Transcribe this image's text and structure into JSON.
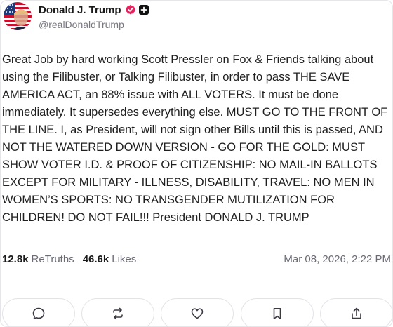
{
  "author": {
    "display_name": "Donald J. Trump",
    "handle": "@realDonaldTrump",
    "avatar_icon": "flag-portrait-avatar",
    "verified_icon": "verified-badge-icon",
    "verified_color": "#e0245e",
    "plus_icon": "plus-badge-icon"
  },
  "post": {
    "text": "Great Job by hard working Scott Pressler on Fox & Friends talking about using the Filibuster, or Talking Filibuster, in order to pass THE SAVE AMERICA ACT, an 88% issue with ALL VOTERS. It must be done immediately. It supersedes everything else. MUST GO TO THE FRONT OF THE LINE. I, as President, will not sign other Bills until this is passed, AND NOT THE WATERED DOWN VERSION - GO FOR THE GOLD: MUST SHOW VOTER I.D. & PROOF OF CITIZENSHIP: NO MAIL-IN BALLOTS EXCEPT FOR MILITARY - ILLNESS, DISABILITY, TRAVEL: NO MEN IN WOMEN’S SPORTS: NO TRANSGENDER MUTILIZATION FOR CHILDREN! DO NOT FAIL!!! President DONALD J. TRUMP"
  },
  "stats": {
    "retruths_count": "12.8k",
    "retruths_label": "ReTruths",
    "likes_count": "46.6k",
    "likes_label": "Likes",
    "timestamp": "Mar 08, 2026, 2:22 PM"
  },
  "actions": [
    {
      "name": "reply",
      "icon": "comment-icon"
    },
    {
      "name": "retruth",
      "icon": "repost-icon"
    },
    {
      "name": "like",
      "icon": "heart-icon"
    },
    {
      "name": "bookmark",
      "icon": "bookmark-icon"
    },
    {
      "name": "share",
      "icon": "share-icon"
    }
  ]
}
